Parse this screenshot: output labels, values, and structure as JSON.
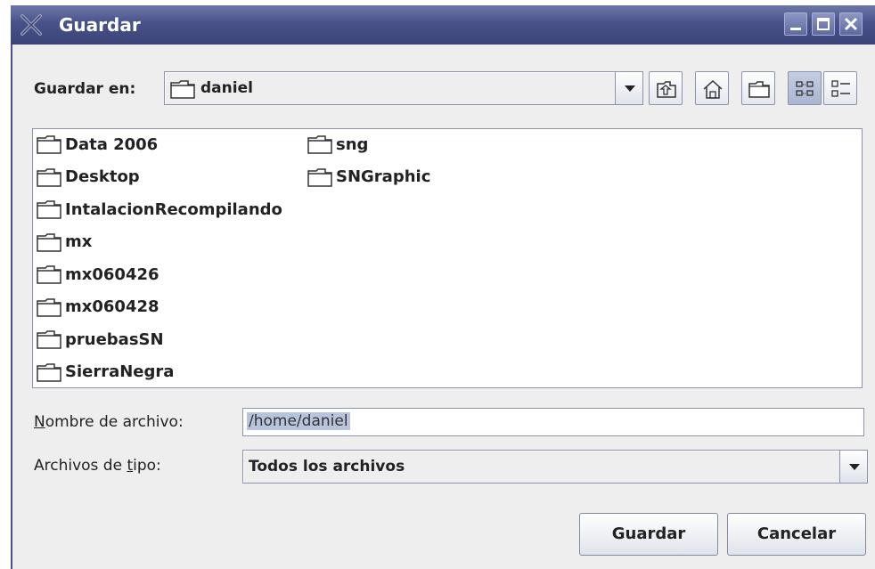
{
  "window": {
    "title": "Guardar"
  },
  "save_in": {
    "label": "Guardar en:",
    "value": "daniel"
  },
  "toolbar": {
    "buttons": [
      {
        "icon": "up-one-level-icon"
      },
      {
        "icon": "home-icon"
      },
      {
        "icon": "new-folder-icon"
      },
      {
        "icon": "list-view-icon",
        "selected": true
      },
      {
        "icon": "details-view-icon"
      }
    ]
  },
  "files": {
    "col1": [
      "Data 2006",
      "Desktop",
      "IntalacionRecompilando",
      "mx",
      "mx060426",
      "mx060428",
      "pruebasSN",
      "SierraNegra"
    ],
    "col2": [
      "sng",
      "SNGraphic"
    ]
  },
  "filename": {
    "label_prefix": "N",
    "label_rest": "ombre de archivo:",
    "value": "/home/daniel"
  },
  "filetype": {
    "label_prefix": "Archivos de ",
    "label_underlined": "t",
    "label_rest": "ipo:",
    "value": "Todos los archivos"
  },
  "buttons": {
    "save": "Guardar",
    "cancel": "Cancelar"
  },
  "colors": {
    "titlebar": "#48528a",
    "selection": "#b8c4dc"
  }
}
